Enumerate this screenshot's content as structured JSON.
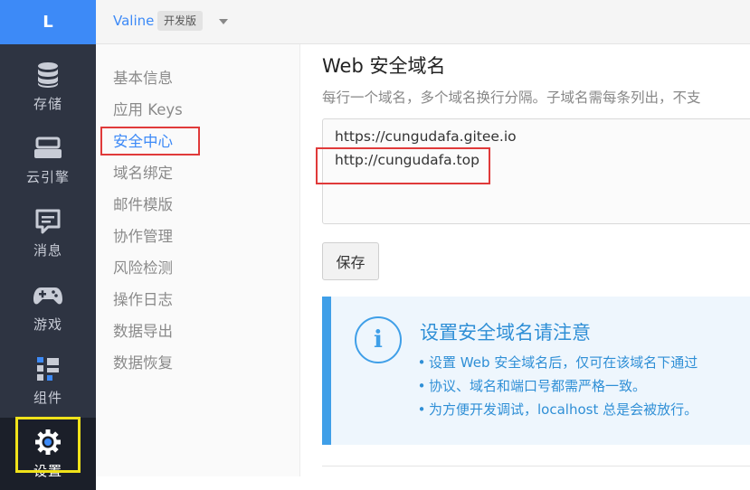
{
  "logo": {
    "letter": "L"
  },
  "rail": {
    "items": [
      {
        "label": "存储",
        "icon": "database-icon"
      },
      {
        "label": "云引擎",
        "icon": "server-icon"
      },
      {
        "label": "消息",
        "icon": "message-icon"
      },
      {
        "label": "游戏",
        "icon": "gamepad-icon"
      },
      {
        "label": "组件",
        "icon": "components-icon"
      },
      {
        "label": "设置",
        "icon": "gear-icon",
        "active": true
      }
    ]
  },
  "header": {
    "app_name": "Valine",
    "env_tag": "开发版"
  },
  "submenu": {
    "items": [
      {
        "label": "基本信息"
      },
      {
        "label": "应用 Keys"
      },
      {
        "label": "安全中心",
        "active": true
      },
      {
        "label": "域名绑定"
      },
      {
        "label": "邮件模版"
      },
      {
        "label": "协作管理"
      },
      {
        "label": "风险检测"
      },
      {
        "label": "操作日志"
      },
      {
        "label": "数据导出"
      },
      {
        "label": "数据恢复"
      }
    ]
  },
  "security": {
    "title": "Web 安全域名",
    "description": "每行一个域名，多个域名换行分隔。子域名需每条列出，不支",
    "domains": [
      "https://cungudafa.gitee.io",
      "http://cungudafa.top"
    ],
    "save_label": "保存"
  },
  "notice": {
    "title": "设置安全域名请注意",
    "items": [
      "设置 Web 安全域名后，仅可在该域名下通过",
      "协议、域名和端口号都需严格一致。",
      "为方便开发调试，localhost 总是会被放行。"
    ]
  },
  "colors": {
    "accent": "#3d8af7",
    "rail_bg": "#2e3442",
    "notice_blue": "#2f8fd6",
    "highlight_red": "#e03a3a",
    "highlight_yellow": "#f0e21a"
  }
}
